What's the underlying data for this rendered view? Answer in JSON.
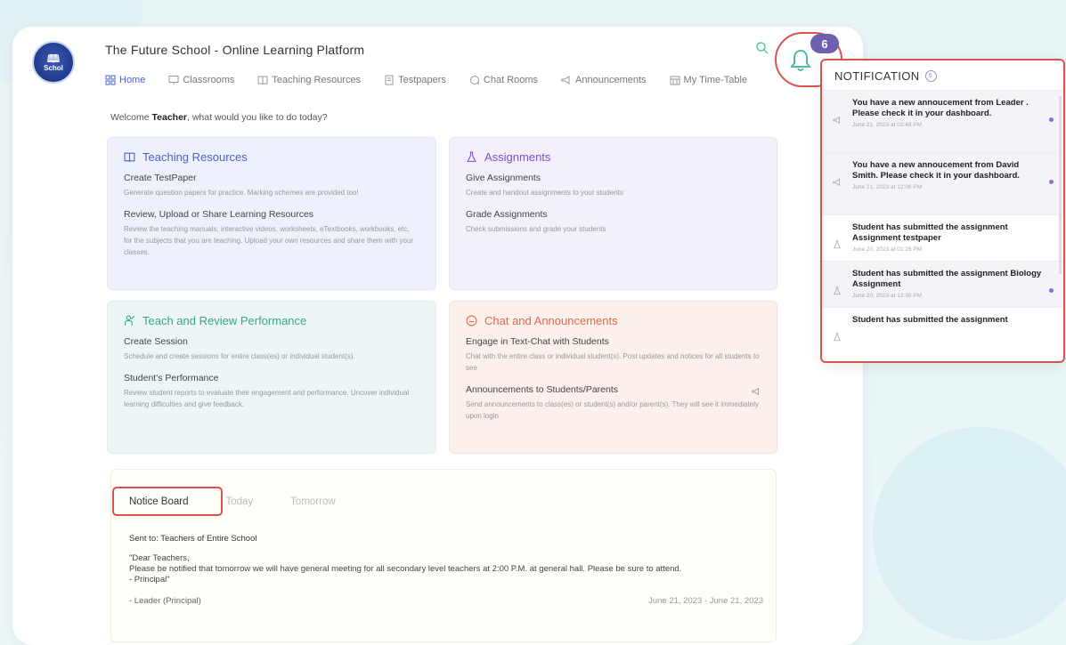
{
  "app": {
    "title": "The Future School - Online Learning Platform",
    "logo_text": "Schol"
  },
  "nav": [
    {
      "label": "Home",
      "icon": "grid-icon",
      "active": true
    },
    {
      "label": "Classrooms",
      "icon": "board-icon"
    },
    {
      "label": "Teaching Resources",
      "icon": "book-icon"
    },
    {
      "label": "Testpapers",
      "icon": "paper-icon"
    },
    {
      "label": "Chat Rooms",
      "icon": "chat-icon"
    },
    {
      "label": "Announcements",
      "icon": "megaphone-icon"
    },
    {
      "label": "My Time-Table",
      "icon": "calendar-icon"
    }
  ],
  "welcome": {
    "prefix": "Welcome ",
    "role": "Teacher",
    "suffix": ", what would you like to do today?"
  },
  "cards": {
    "teaching": {
      "title": "Teaching Resources",
      "items": [
        {
          "title": "Create TestPaper",
          "desc": "Generate question papers for practice. Marking schemes are provided too!"
        },
        {
          "title": "Review, Upload or Share Learning Resources",
          "desc": "Review the teaching manuals, interactive videos, worksheets, eTextbooks, workbooks, etc, for the subjects that you are teaching. Upload your own resources and share them with your classes."
        }
      ]
    },
    "assignments": {
      "title": "Assignments",
      "items": [
        {
          "title": "Give Assignments",
          "desc": "Create and handout assignments to your students"
        },
        {
          "title": "Grade Assignments",
          "desc": "Check submissions and grade your students"
        }
      ]
    },
    "performance": {
      "title": "Teach and Review Performance",
      "items": [
        {
          "title": "Create Session",
          "desc": "Schedule and create sessions for entire class(es) or individual student(s)."
        },
        {
          "title": "Student's Performance",
          "desc": "Review student reports to evaluate their engagement and performance. Uncover individual learning difficulties and give feedback."
        }
      ]
    },
    "chat": {
      "title": "Chat and Announcements",
      "items": [
        {
          "title": "Engage in Text-Chat with Students",
          "desc": "Chat with the entire class or individual student(s). Post updates and notices for all students to see"
        },
        {
          "title": "Announcements to Students/Parents",
          "desc": "Send announcements to class(es) or student(s) and/or parent(s). They will see it immediately upon login"
        }
      ]
    }
  },
  "notice_board": {
    "tabs": [
      "Notice Board",
      "Today",
      "Tomorrow"
    ],
    "sent_to": "Sent to: Teachers of Entire School",
    "message_l1": "\"Dear Teachers,",
    "message_l2": "Please be notified that tomorrow we will have general meeting for all secondary level teachers at 2:00 P.M. at general hall. Please be sure to attend.",
    "message_l3": "- Principal\"",
    "author": "- Leader (Principal)",
    "dates": "June 21, 2023 - June 21, 2023"
  },
  "notifications": {
    "badge_count": "6",
    "header": "NOTIFICATION",
    "header_count": "6",
    "items": [
      {
        "text": "You have a new annoucement from Leader . Please check it in your dashboard.",
        "time": "June 21, 2023 at 02:48 PM",
        "icon": "megaphone-icon",
        "unread": true
      },
      {
        "text": "You have a new annoucement from David Smith. Please check it in your dashboard.",
        "time": "June 21, 2023 at 12:06 PM",
        "icon": "megaphone-icon",
        "unread": true
      },
      {
        "text": "Student has submitted the assignment Assignment testpaper",
        "time": "June 20, 2023 at 01:26 PM",
        "icon": "flask-icon",
        "unread": false
      },
      {
        "text": "Student has submitted the assignment Biology Assignment",
        "time": "June 20, 2023 at 12:30 PM",
        "icon": "flask-icon",
        "unread": true
      },
      {
        "text": "Student has submitted the assignment",
        "time": "",
        "icon": "flask-icon",
        "unread": false
      }
    ]
  },
  "colors": {
    "accent_blue": "#4a63c9",
    "accent_purple": "#7a52c9",
    "accent_teal": "#3aa38a",
    "accent_coral": "#e06a4a",
    "highlight_red": "#d9534f",
    "badge_purple": "#6f5fb0"
  }
}
